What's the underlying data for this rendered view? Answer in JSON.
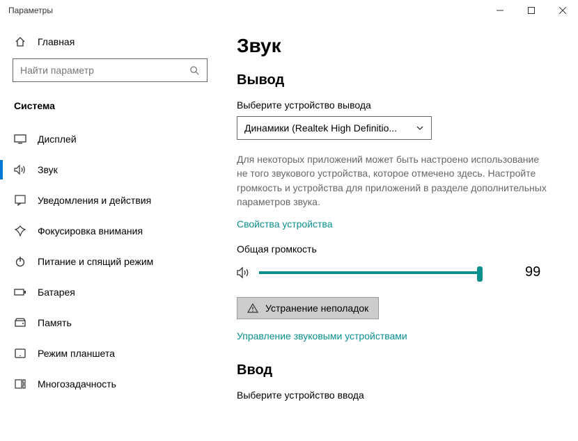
{
  "window": {
    "title": "Параметры"
  },
  "sidebar": {
    "home": "Главная",
    "search_placeholder": "Найти параметр",
    "category": "Система",
    "items": [
      {
        "label": "Дисплей"
      },
      {
        "label": "Звук"
      },
      {
        "label": "Уведомления и действия"
      },
      {
        "label": "Фокусировка внимания"
      },
      {
        "label": "Питание и спящий режим"
      },
      {
        "label": "Батарея"
      },
      {
        "label": "Память"
      },
      {
        "label": "Режим планшета"
      },
      {
        "label": "Многозадачность"
      }
    ]
  },
  "content": {
    "title": "Звук",
    "output_heading": "Вывод",
    "output_select_label": "Выберите устройство вывода",
    "output_device": "Динамики (Realtek High Definitio...",
    "output_desc": "Для некоторых приложений может быть настроено использование не того звукового устройства, которое отмечено здесь. Настройте громкость и устройства для приложений в разделе дополнительных параметров звука.",
    "device_props_link": "Свойства устройства",
    "volume_label": "Общая громкость",
    "volume_value": "99",
    "troubleshoot": "Устранение неполадок",
    "manage_devices_link": "Управление звуковыми устройствами",
    "input_heading": "Ввод",
    "input_select_label": "Выберите устройство ввода"
  }
}
